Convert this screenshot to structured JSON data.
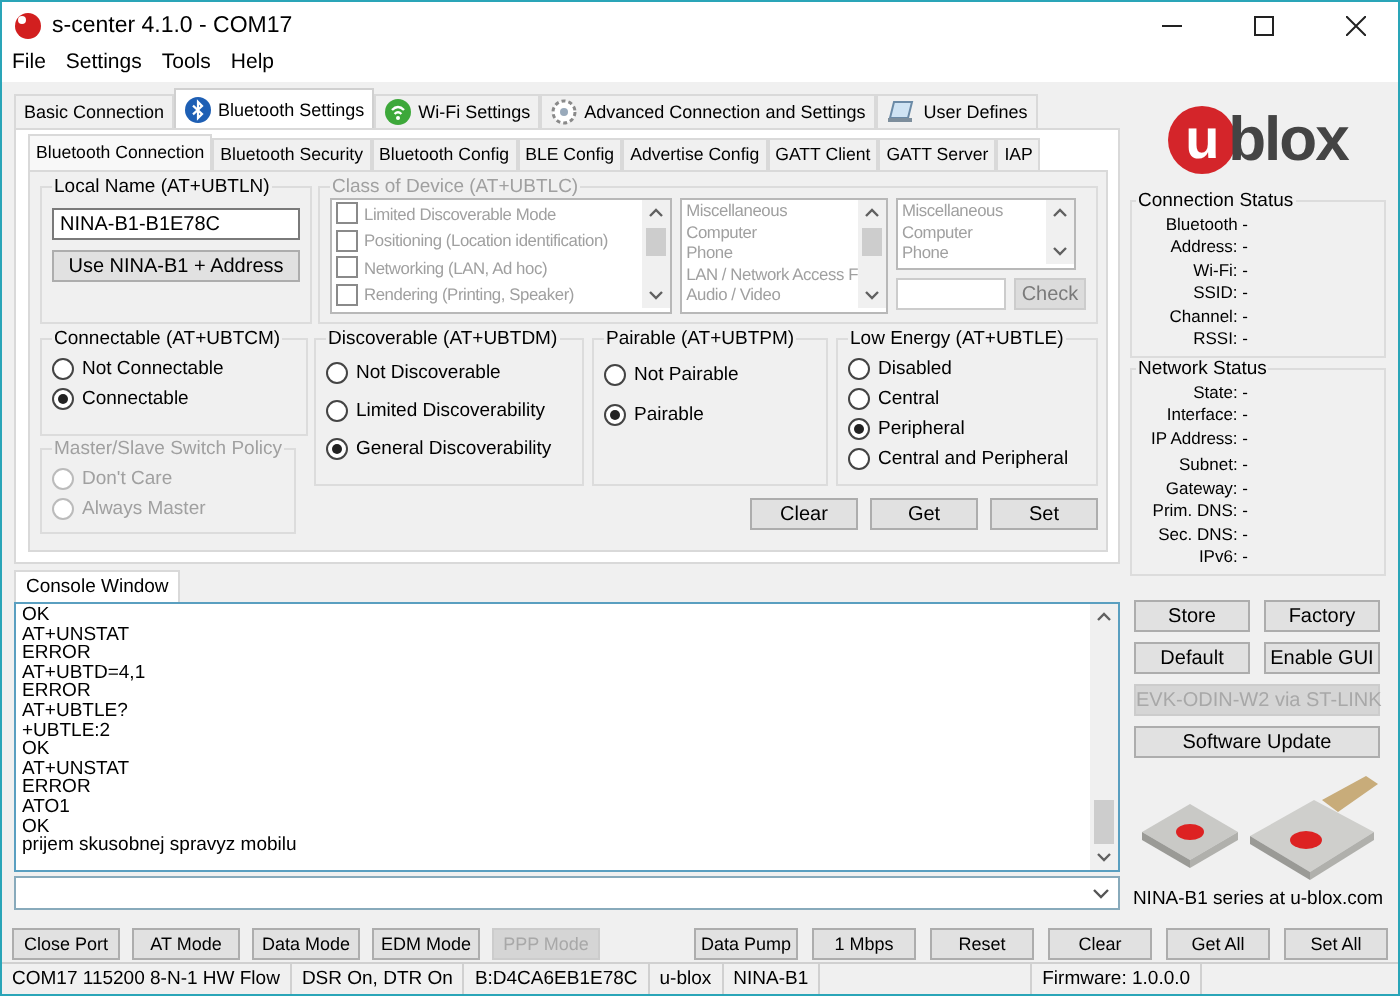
{
  "window": {
    "title": "s-center 4.1.0 - COM17"
  },
  "menu": [
    "File",
    "Settings",
    "Tools",
    "Help"
  ],
  "main_tabs": [
    {
      "label": "Basic Connection",
      "selected": false
    },
    {
      "label": "Bluetooth Settings",
      "selected": true
    },
    {
      "label": "Wi-Fi Settings",
      "selected": false
    },
    {
      "label": "Advanced Connection and Settings",
      "selected": false
    },
    {
      "label": "User Defines",
      "selected": false
    }
  ],
  "sub_tabs": [
    {
      "label": "Bluetooth Connection",
      "selected": true
    },
    {
      "label": "Bluetooth Security",
      "selected": false
    },
    {
      "label": "Bluetooth Config",
      "selected": false
    },
    {
      "label": "BLE Config",
      "selected": false
    },
    {
      "label": "Advertise Config",
      "selected": false
    },
    {
      "label": "GATT Client",
      "selected": false
    },
    {
      "label": "GATT Server",
      "selected": false
    },
    {
      "label": "IAP",
      "selected": false
    }
  ],
  "local_name": {
    "title": "Local Name (AT+UBTLN)",
    "value": "NINA-B1-B1E78C",
    "button": "Use NINA-B1 + Address"
  },
  "class_of_device": {
    "title": "Class of Device (AT+UBTLC)",
    "disabled": true,
    "services": [
      {
        "label": "Limited Discoverable Mode",
        "checked": false
      },
      {
        "label": "Positioning (Location identification)",
        "checked": false
      },
      {
        "label": "Networking (LAN, Ad hoc)",
        "checked": false
      },
      {
        "label": "Rendering (Printing, Speaker)",
        "checked": false
      }
    ],
    "major_classes": [
      "Miscellaneous",
      "Computer",
      "Phone",
      "LAN / Network Access F",
      "Audio / Video"
    ],
    "minor_classes": [
      "Miscellaneous",
      "Computer",
      "Phone"
    ],
    "check_button": "Check"
  },
  "connectable": {
    "title": "Connectable (AT+UBTCM)",
    "options": [
      {
        "label": "Not Connectable",
        "selected": false
      },
      {
        "label": "Connectable",
        "selected": true
      }
    ]
  },
  "master_slave": {
    "title": "Master/Slave Switch Policy",
    "disabled": true,
    "options": [
      {
        "label": "Don't Care",
        "selected": false
      },
      {
        "label": "Always Master",
        "selected": false
      }
    ]
  },
  "discoverable": {
    "title": "Discoverable (AT+UBTDM)",
    "options": [
      {
        "label": "Not Discoverable",
        "selected": false
      },
      {
        "label": "Limited Discoverability",
        "selected": false
      },
      {
        "label": "General Discoverability",
        "selected": true
      }
    ]
  },
  "pairable": {
    "title": "Pairable (AT+UBTPM)",
    "options": [
      {
        "label": "Not Pairable",
        "selected": false
      },
      {
        "label": "Pairable",
        "selected": true
      }
    ]
  },
  "low_energy": {
    "title": "Low Energy (AT+UBTLE)",
    "options": [
      {
        "label": "Disabled",
        "selected": false
      },
      {
        "label": "Central",
        "selected": false
      },
      {
        "label": "Peripheral",
        "selected": true
      },
      {
        "label": "Central and Peripheral",
        "selected": false
      }
    ]
  },
  "action_buttons": [
    "Clear",
    "Get",
    "Set"
  ],
  "console": {
    "tab": "Console Window",
    "lines": [
      "OK",
      "AT+UNSTAT",
      "ERROR",
      "AT+UBTD=4,1",
      "ERROR",
      "AT+UBTLE?",
      "+UBTLE:2",
      "OK",
      "AT+UNSTAT",
      "ERROR",
      "ATO1",
      "OK",
      "prijem skusobnej spravyz mobilu"
    ]
  },
  "logo": {
    "mark": "u",
    "text": "blox"
  },
  "connection_status": {
    "title": "Connection Status",
    "fields": [
      "Bluetooth -",
      "Address: -",
      "Wi-Fi: -",
      "SSID: -",
      "Channel: -",
      "RSSI: -"
    ]
  },
  "network_status": {
    "title": "Network Status",
    "fields": [
      "State: -",
      "Interface: -",
      "IP Address: -",
      "Subnet: -",
      "Gateway: -",
      "Prim. DNS: -",
      "Sec. DNS: -",
      "IPv6: -"
    ]
  },
  "side_buttons": [
    {
      "label": "Store",
      "kind": "half",
      "disabled": false
    },
    {
      "label": "Factory",
      "kind": "half",
      "disabled": false
    },
    {
      "label": "Default",
      "kind": "half",
      "disabled": false
    },
    {
      "label": "Enable GUI",
      "kind": "half",
      "disabled": false
    },
    {
      "label": "EVK-ODIN-W2 via ST-LINK",
      "kind": "wide",
      "disabled": true
    },
    {
      "label": "Software Update",
      "kind": "wide",
      "disabled": false
    }
  ],
  "product_caption": "NINA-B1 series at u-blox.com",
  "bottom_buttons_left": [
    {
      "label": "Close Port",
      "disabled": false
    },
    {
      "label": "AT Mode",
      "disabled": false
    },
    {
      "label": "Data Mode",
      "disabled": false
    },
    {
      "label": "EDM Mode",
      "disabled": false
    },
    {
      "label": "PPP Mode",
      "disabled": true
    }
  ],
  "bottom_buttons_right": [
    {
      "label": "Data Pump",
      "disabled": false
    },
    {
      "label": "1 Mbps",
      "disabled": false
    },
    {
      "label": "Reset",
      "disabled": false
    },
    {
      "label": "Clear",
      "disabled": false
    },
    {
      "label": "Get All",
      "disabled": false
    },
    {
      "label": "Set All",
      "disabled": false
    }
  ],
  "status_bar": [
    "COM17 115200 8-N-1 HW Flow",
    "DSR On, DTR On",
    "B:D4CA6EB1E78C",
    "u-blox",
    "NINA-B1",
    "Firmware: 1.0.0.0"
  ]
}
